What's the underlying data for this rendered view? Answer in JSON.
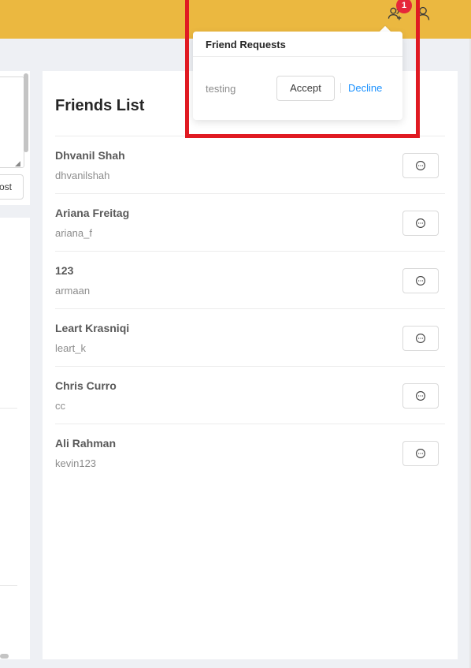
{
  "header": {
    "background_color": "#ebb840",
    "friend_requests_icon": "user-add-icon",
    "profile_icon": "user-icon",
    "notification_count": "1"
  },
  "friend_requests_popover": {
    "title": "Friend Requests",
    "requests": [
      {
        "name": "testing",
        "accept_label": "Accept",
        "decline_label": "Decline"
      }
    ]
  },
  "left_panel": {
    "post_button_label": "ost"
  },
  "friends": {
    "title": "Friends List",
    "message_icon": "message-icon",
    "items": [
      {
        "name": "Dhvanil Shah",
        "username": "dhvanilshah"
      },
      {
        "name": "Ariana Freitag",
        "username": "ariana_f"
      },
      {
        "name": "123",
        "username": "armaan"
      },
      {
        "name": "Leart Krasniqi",
        "username": "leart_k"
      },
      {
        "name": "Chris Curro",
        "username": "cc"
      },
      {
        "name": "Ali Rahman",
        "username": "kevin123"
      }
    ]
  },
  "colors": {
    "accent_link": "#1890ff",
    "badge": "#e5273a",
    "annotation_box": "#e01a22"
  }
}
